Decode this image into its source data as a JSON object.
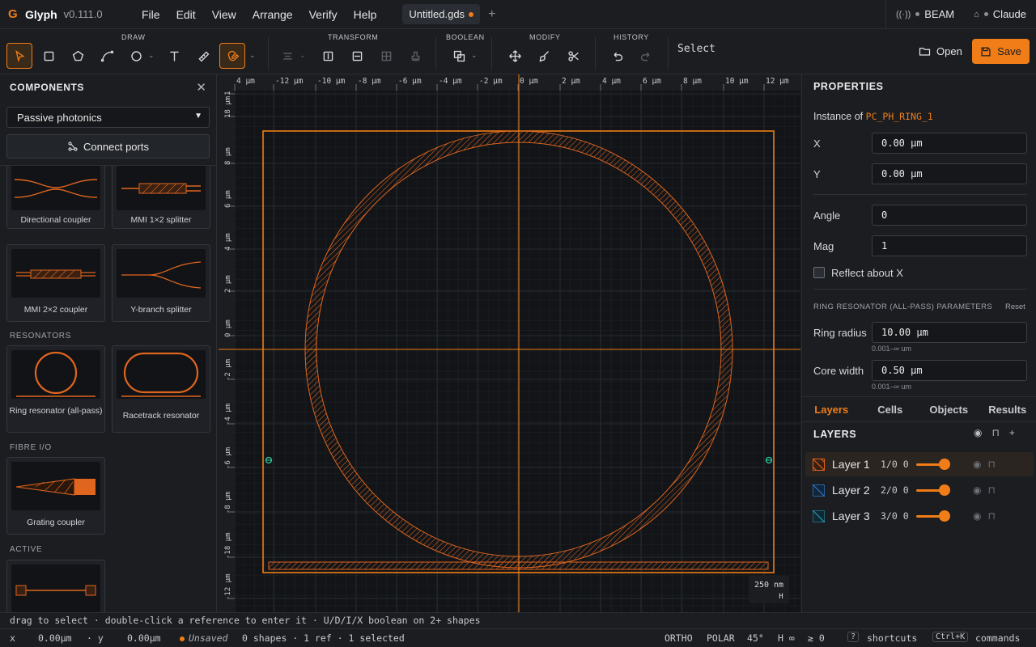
{
  "app": {
    "name": "Glyph",
    "version": "v0.111.0"
  },
  "menu": [
    "File",
    "Edit",
    "View",
    "Arrange",
    "Verify",
    "Help"
  ],
  "tabs": [
    {
      "label": "Untitled.gds",
      "unsaved": true
    }
  ],
  "status_right": {
    "beam": "BEAM",
    "assistant": "Claude"
  },
  "toolbar": {
    "groups": {
      "draw": "DRAW",
      "transform": "TRANSFORM",
      "boolean": "BOOLEAN",
      "modify": "MODIFY",
      "history": "HISTORY"
    },
    "active_tool": "Select",
    "open_label": "Open",
    "save_label": "Save",
    "accent": "#f07d17"
  },
  "left_panel": {
    "title": "COMPONENTS",
    "library": "Passive photonics",
    "connect_ports": "Connect ports",
    "cards": [
      {
        "label": "Directional coupler"
      },
      {
        "label": "MMI 1×2 splitter"
      },
      {
        "label": "MMI 2×2 coupler"
      },
      {
        "label": "Y-branch splitter"
      }
    ],
    "sections": [
      {
        "title": "RESONATORS",
        "cards": [
          {
            "label": "Ring resonator (all-pass)"
          },
          {
            "label": "Racetrack resonator"
          }
        ]
      },
      {
        "title": "FIBRE I/O",
        "cards": [
          {
            "label": "Grating coupler"
          }
        ]
      },
      {
        "title": "ACTIVE",
        "cards": [
          {
            "label": ""
          }
        ]
      }
    ]
  },
  "canvas": {
    "x_ticks": [
      "4 µm",
      "-12 µm",
      "-10 µm",
      "-8 µm",
      "-6 µm",
      "-4 µm",
      "-2 µm",
      "0 µm",
      "2 µm",
      "4 µm",
      "6 µm",
      "8 µm",
      "10 µm",
      "12 µm"
    ],
    "y_ticks": [
      "1",
      "18 µm",
      "8 µm",
      "6 µm",
      "4 µm",
      "2 µm",
      "0 µm",
      "-2 µm",
      "-4 µm",
      "-6 µm",
      "-8 µm",
      "-18 µm",
      "-12 µm"
    ],
    "scale_label": "250 nm",
    "scale_sub": "H"
  },
  "properties": {
    "title": "PROPERTIES",
    "instance_prefix": "Instance of",
    "instance_name": "PC_PH_RING_1",
    "x_label": "X",
    "x": "0.00 µm",
    "y_label": "Y",
    "y": "0.00 µm",
    "angle_label": "Angle",
    "angle": "0",
    "mag_label": "Mag",
    "mag": "1",
    "reflect_label": "Reflect about X",
    "params_title": "RING RESONATOR (ALL-PASS) PARAMETERS",
    "reset": "Reset",
    "ring_radius_label": "Ring radius",
    "ring_radius": "10.00 µm",
    "ring_radius_hint": "0.001–∞ um",
    "core_width_label": "Core width",
    "core_width": "0.50 µm",
    "core_width_hint": "0.001–∞ um"
  },
  "right_tabs": [
    "Layers",
    "Cells",
    "Objects",
    "Results"
  ],
  "layers": {
    "title": "LAYERS",
    "items": [
      {
        "name": "Layer 1",
        "num": "1/0",
        "opacity": "0",
        "color": "#e0651e"
      },
      {
        "name": "Layer 2",
        "num": "2/0",
        "opacity": "0",
        "color": "#2f7fd6"
      },
      {
        "name": "Layer 3",
        "num": "3/0",
        "opacity": "0",
        "color": "#2aa8c9"
      }
    ]
  },
  "hint": "drag to select · double-click a reference to enter it · U/D/I/X boolean on 2+ shapes",
  "statusbar": {
    "x_label": "x",
    "x_val": "0.00µm",
    "y_label": "· y",
    "y_val": "0.00µm",
    "unsaved": "Unsaved",
    "selection": "0 shapes · 1 ref · 1 selected",
    "ortho": "ORTHO",
    "polar": "POLAR",
    "angle": "45°",
    "h": "H ∞",
    "geq": "≥ 0",
    "shortcuts_key": "?",
    "shortcuts": "shortcuts",
    "commands_key": "Ctrl+K",
    "commands": "commands"
  }
}
